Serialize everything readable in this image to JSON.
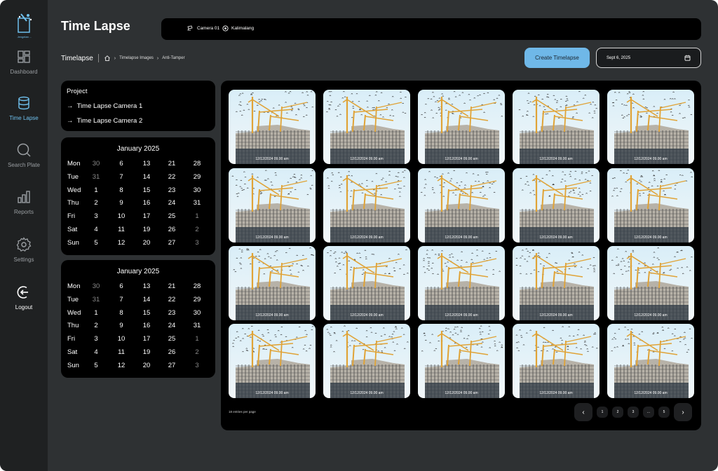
{
  "app": {
    "title": "Time Lapse",
    "logo_text": "Jengelan ...",
    "accent": "#6fb8e8"
  },
  "sidebar": {
    "items": [
      {
        "label": "Dashboard",
        "icon": "dashboard-icon",
        "active": false
      },
      {
        "label": "Time Lapse",
        "icon": "database-icon",
        "active": true
      },
      {
        "label": "Search Plate",
        "icon": "search-icon",
        "active": false
      },
      {
        "label": "Reports",
        "icon": "bar-chart-icon",
        "active": false
      },
      {
        "label": "Settings",
        "icon": "gear-icon",
        "active": false
      },
      {
        "label": "Logout",
        "icon": "logout-icon",
        "active": false
      }
    ]
  },
  "topbar": {
    "camera": "Camera 01",
    "location": "Kalimalang"
  },
  "breadcrumb": {
    "main": "Timelapse",
    "items": [
      "Timelapse Images",
      "Anti-Tamper"
    ]
  },
  "actions": {
    "create_label": "Create Timelapse",
    "date_value": "Sept 6, 2025"
  },
  "project": {
    "title": "Project",
    "items": [
      "Time Lapse Camera 1",
      "Time Lapse Camera 2"
    ]
  },
  "calendars": [
    {
      "title": "January 2025",
      "rows": [
        {
          "day": "Mon",
          "nums": [
            "30",
            "6",
            "13",
            "21",
            "28"
          ]
        },
        {
          "day": "Tue",
          "nums": [
            "31",
            "7",
            "14",
            "22",
            "29"
          ]
        },
        {
          "day": "Wed",
          "nums": [
            "1",
            "8",
            "15",
            "23",
            "30"
          ]
        },
        {
          "day": "Thu",
          "nums": [
            "2",
            "9",
            "16",
            "24",
            "31"
          ]
        },
        {
          "day": "Fri",
          "nums": [
            "3",
            "10",
            "17",
            "25",
            "1"
          ]
        },
        {
          "day": "Sat",
          "nums": [
            "4",
            "11",
            "19",
            "26",
            "2"
          ]
        },
        {
          "day": "Sun",
          "nums": [
            "5",
            "12",
            "20",
            "27",
            "3"
          ]
        }
      ]
    },
    {
      "title": "January 2025",
      "rows": [
        {
          "day": "Mon",
          "nums": [
            "30",
            "6",
            "13",
            "21",
            "28"
          ]
        },
        {
          "day": "Tue",
          "nums": [
            "31",
            "7",
            "14",
            "22",
            "29"
          ]
        },
        {
          "day": "Wed",
          "nums": [
            "1",
            "8",
            "15",
            "23",
            "30"
          ]
        },
        {
          "day": "Thu",
          "nums": [
            "2",
            "9",
            "16",
            "24",
            "31"
          ]
        },
        {
          "day": "Fri",
          "nums": [
            "3",
            "10",
            "17",
            "25",
            "1"
          ]
        },
        {
          "day": "Sat",
          "nums": [
            "4",
            "11",
            "19",
            "26",
            "2"
          ]
        },
        {
          "day": "Sun",
          "nums": [
            "5",
            "12",
            "20",
            "27",
            "3"
          ]
        }
      ]
    }
  ],
  "gallery": {
    "thumb_label": "12/12/2024 09.00 am",
    "entries_label": "18 entries per page"
  },
  "pagination": {
    "prev_icon": "chevron-left-icon",
    "next_icon": "chevron-right-icon",
    "pages": [
      "1",
      "2",
      "3",
      "...",
      "5"
    ]
  }
}
